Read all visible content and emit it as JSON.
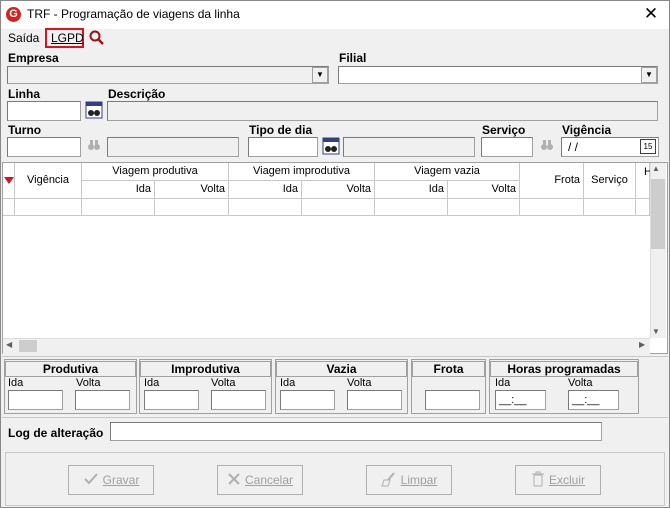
{
  "window": {
    "title": "TRF - Programação de viagens da linha",
    "logo": "G",
    "close": "✕"
  },
  "menu": {
    "saida": "Saída",
    "lgpd": "LGPD"
  },
  "labels": {
    "empresa": "Empresa",
    "filial": "Filial",
    "linha": "Linha",
    "descricao": "Descrição",
    "turno": "Turno",
    "tipo_dia": "Tipo de dia",
    "servico": "Serviço",
    "vigencia": "Vigência"
  },
  "fields": {
    "vigencia_value": " / /",
    "calendar_icon_text": "15"
  },
  "grid": {
    "col_vigencia": "Vigência",
    "group_produtiva": "Viagem produtiva",
    "group_improdutiva": "Viagem improdutiva",
    "group_vazia": "Viagem vazia",
    "ida": "Ida",
    "volta": "Volta",
    "frota": "Frota",
    "servico": "Serviço",
    "extra": "H"
  },
  "summary": {
    "produtiva": "Produtiva",
    "improdutiva": "Improdutiva",
    "vazia": "Vazia",
    "frota": "Frota",
    "horas": "Horas programadas",
    "ida": "Ida",
    "volta": "Volta",
    "time_mask": "__:__"
  },
  "log": {
    "label": "Log de alteração"
  },
  "buttons": {
    "gravar": "Gravar",
    "cancelar": "Cancelar",
    "limpar": "Limpar",
    "excluir": "Excluir"
  },
  "colors": {
    "accent_red": "#e0101e",
    "logo_red": "#d82020",
    "sort_marker": "#e0101e"
  },
  "icons": {
    "search": "magnifier-icon",
    "binoculars": "binoculars-icon",
    "calendar": "calendar-icon",
    "check": "check-icon",
    "x": "cancel-icon",
    "broom": "broom-icon",
    "trash": "trash-icon"
  }
}
